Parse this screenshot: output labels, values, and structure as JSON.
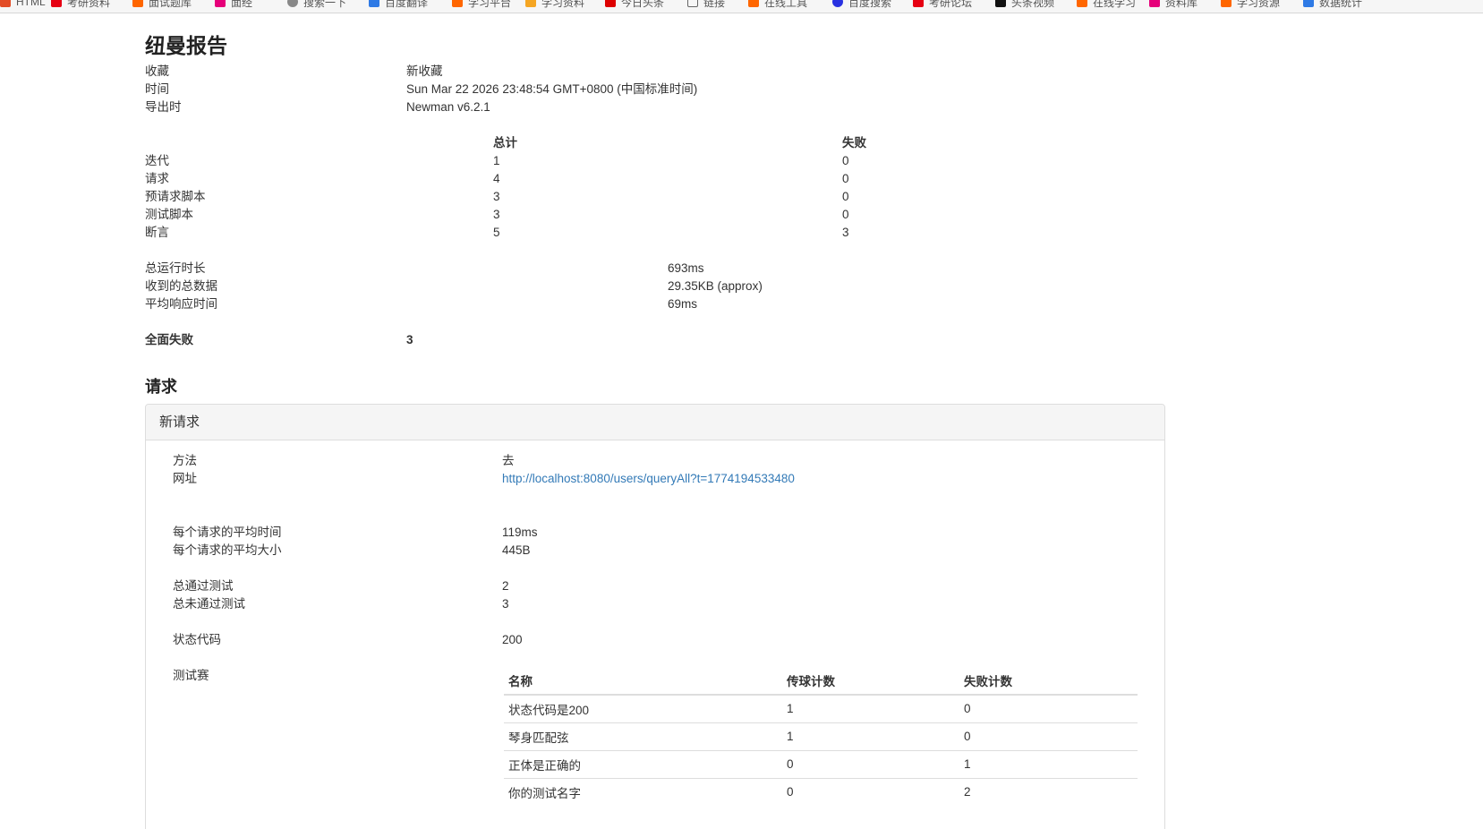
{
  "bookmarks": [
    {
      "label": "HTML",
      "color": "#e34c26"
    },
    {
      "label": "考研资料",
      "color": "#e60012"
    },
    {
      "label": "面试题库",
      "color": "#f60"
    },
    {
      "label": "面经",
      "color": "#e6007a"
    },
    {
      "label": "搜索一下",
      "color": "#888"
    },
    {
      "label": "百度翻译",
      "color": "#2f7ae5"
    },
    {
      "label": "学习平台",
      "color": "#f60"
    },
    {
      "label": "学习资料",
      "color": "#f5a623"
    },
    {
      "label": "今日头条",
      "color": "#d00"
    },
    {
      "label": "链接",
      "color": "#666"
    },
    {
      "label": "在线工具",
      "color": "#f60"
    },
    {
      "label": "百度搜索",
      "color": "#2932e1"
    },
    {
      "label": "考研论坛",
      "color": "#e60012"
    },
    {
      "label": "头条视频",
      "color": "#111"
    },
    {
      "label": "在线学习",
      "color": "#f60"
    },
    {
      "label": "资料库",
      "color": "#e6007a"
    },
    {
      "label": "学习资源",
      "color": "#f60"
    },
    {
      "label": "数据统计",
      "color": "#2f7ae5"
    }
  ],
  "report": {
    "title": "纽曼报告",
    "meta": [
      {
        "label": "收藏",
        "value": "新收藏"
      },
      {
        "label": "时间",
        "value": "Sun Mar 22 2026 23:48:54 GMT+0800 (中国标准时间)"
      },
      {
        "label": "导出时",
        "value": "Newman v6.2.1"
      }
    ],
    "stats_header": {
      "total": "总计",
      "failed": "失败"
    },
    "stats": [
      {
        "label": "迭代",
        "total": "1",
        "failed": "0"
      },
      {
        "label": "请求",
        "total": "4",
        "failed": "0"
      },
      {
        "label": "预请求脚本",
        "total": "3",
        "failed": "0"
      },
      {
        "label": "测试脚本",
        "total": "3",
        "failed": "0"
      },
      {
        "label": "断言",
        "total": "5",
        "failed": "3"
      }
    ],
    "timing": [
      {
        "label": "总运行时长",
        "value": "693ms"
      },
      {
        "label": "收到的总数据",
        "value": "29.35KB (approx)"
      },
      {
        "label": "平均响应时间",
        "value": "69ms"
      }
    ],
    "total_failures": {
      "label": "全面失败",
      "value": "3"
    }
  },
  "requests_section": {
    "title": "请求",
    "request": {
      "name": "新请求",
      "method_label": "方法",
      "method": "去",
      "url_label": "网址",
      "url": "http://localhost:8080/users/queryAll?t=1774194533480",
      "avg_time_label": "每个请求的平均时间",
      "avg_time": "119ms",
      "avg_size_label": "每个请求的平均大小",
      "avg_size": "445B",
      "passed_label": "总通过测试",
      "passed": "2",
      "failed_label": "总未通过测试",
      "failed": "3",
      "status_label": "状态代码",
      "status": "200",
      "tests_label": "测试赛",
      "tests_header": {
        "name": "名称",
        "pass": "传球计数",
        "fail": "失败计数"
      },
      "tests": [
        {
          "name": "状态代码是200",
          "pass": "1",
          "fail": "0"
        },
        {
          "name": "琴身匹配弦",
          "pass": "1",
          "fail": "0"
        },
        {
          "name": "正体是正确的",
          "pass": "0",
          "fail": "1"
        },
        {
          "name": "你的测试名字",
          "pass": "0",
          "fail": "2"
        }
      ]
    }
  }
}
